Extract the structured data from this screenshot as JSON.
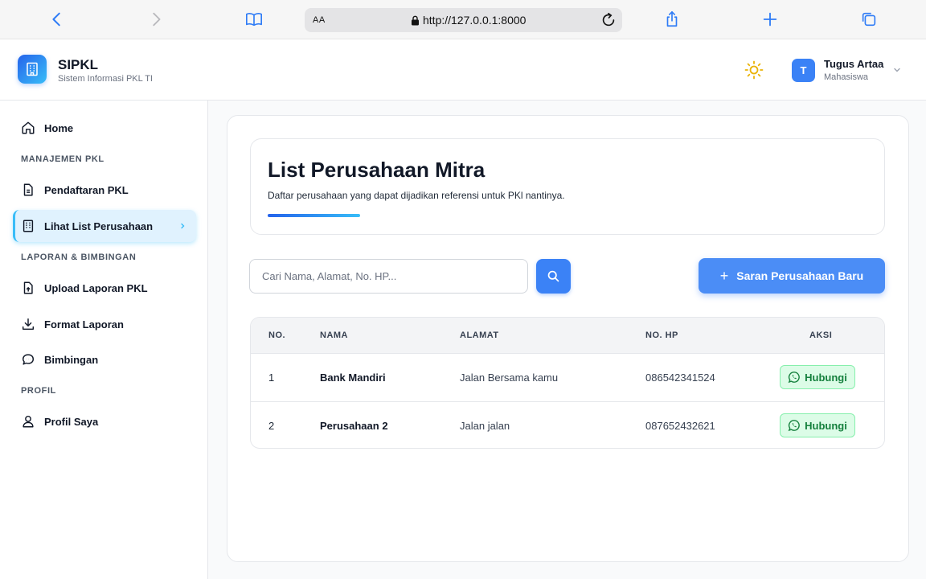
{
  "browser": {
    "aa_label": "AA",
    "url": "http://127.0.0.1:8000",
    "icons": [
      "back-icon",
      "forward-icon",
      "bookmarks-icon",
      "lock-icon",
      "reload-icon",
      "share-icon",
      "new-tab-icon",
      "tabs-icon"
    ]
  },
  "header": {
    "brand": "SIPKL",
    "brand_sub": "Sistem Informasi PKL TI",
    "user": {
      "initial": "T",
      "name": "Tugus Artaa",
      "role": "Mahasiswa"
    }
  },
  "sidebar": {
    "home": "Home",
    "sections": {
      "manajemen": "MANAJEMEN PKL",
      "laporan": "LAPORAN & BIMBINGAN",
      "profil": "PROFIL"
    },
    "items": {
      "pendaftaran": "Pendaftaran PKL",
      "lihat_list": "Lihat List Perusahaan",
      "upload": "Upload Laporan PKL",
      "format": "Format Laporan",
      "bimbingan": "Bimbingan",
      "profil_saya": "Profil Saya"
    },
    "active_item": "Lihat List Perusahaan"
  },
  "main": {
    "title": "List Perusahaan Mitra",
    "description": "Daftar perusahaan yang dapat dijadikan referensi untuk PKl nantinya.",
    "search": {
      "placeholder": "Cari Nama, Alamat, No. HP...",
      "value": ""
    },
    "add_button": "Saran Perusahaan Baru",
    "table": {
      "headers": {
        "no": "NO.",
        "nama": "NAMA",
        "alamat": "ALAMAT",
        "nohp": "NO. HP",
        "aksi": "AKSI"
      },
      "rows": [
        {
          "no": "1",
          "nama": "Bank Mandiri",
          "alamat": "Jalan Bersama kamu",
          "nohp": "086542341524",
          "action": "Hubungi"
        },
        {
          "no": "2",
          "nama": "Perusahaan 2",
          "alamat": "Jalan jalan",
          "nohp": "087652432621",
          "action": "Hubungi"
        }
      ]
    }
  },
  "colors": {
    "primary": "#3b82f6",
    "active_bg": "#e0f2fe",
    "whatsapp_green": "#15803d",
    "sun_yellow": "#eab308"
  }
}
